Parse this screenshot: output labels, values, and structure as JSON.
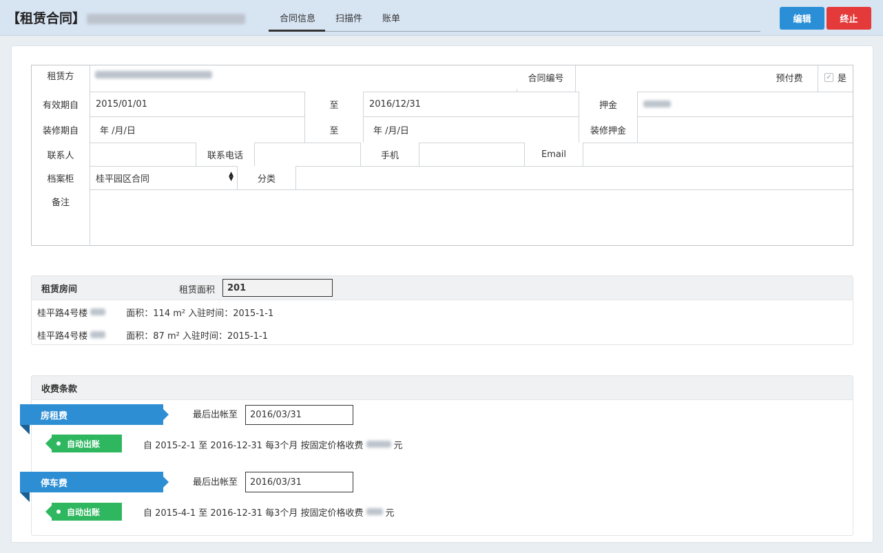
{
  "header": {
    "title": "【租赁合同】",
    "tabs": [
      "合同信息",
      "扫描件",
      "账单"
    ],
    "edit_label": "编辑",
    "stop_label": "终止"
  },
  "contract": {
    "lessee_label": "租赁方",
    "contract_no_label": "合同编号",
    "prepay_label": "预付费",
    "prepay_value": "是",
    "valid_from_label": "有效期自",
    "valid_from": "2015/01/01",
    "to_label": "至",
    "valid_to": "2016/12/31",
    "deposit_label": "押金",
    "reno_from_label": "装修期自",
    "reno_from": "年 /月/日",
    "reno_to": "年 /月/日",
    "reno_deposit_label": "装修押金",
    "contact_label": "联系人",
    "phone_label": "联系电话",
    "mobile_label": "手机",
    "email_label": "Email",
    "cabinet_label": "档案柜",
    "cabinet_value": "桂平园区合同",
    "category_label": "分类",
    "remark_label": "备注"
  },
  "rooms": {
    "title": "租赁房间",
    "area_label": "租赁面积",
    "area_value": "201",
    "items": [
      {
        "building": "桂平路4号楼",
        "detail": "面积：114 m² 入驻时间：2015-1-1"
      },
      {
        "building": "桂平路4号楼",
        "detail": "面积：87 m² 入驻时间：2015-1-1"
      }
    ]
  },
  "fees": {
    "title": "收费条款",
    "last_bill_label": "最后出帐至",
    "auto_label": "自动出账",
    "unit": "元",
    "items": [
      {
        "name": "房租费",
        "last_bill": "2016/03/31",
        "desc": "自 2015-2-1 至 2016-12-31 每3个月 按固定价格收费"
      },
      {
        "name": "停车费",
        "last_bill": "2016/03/31",
        "desc": "自 2015-4-1 至 2016-12-31 每3个月 按固定价格收费"
      }
    ]
  }
}
